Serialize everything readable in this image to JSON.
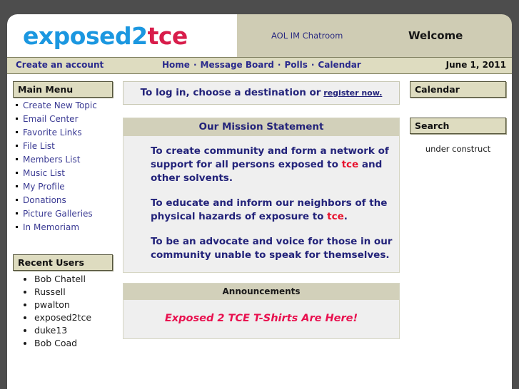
{
  "header": {
    "logo_prefix": "exposed2",
    "logo_suffix": "tce",
    "chatroom_link": "AOL IM Chatroom",
    "welcome": "Welcome"
  },
  "navbar": {
    "create_account": "Create an account",
    "links": [
      "Home",
      "Message Board",
      "Polls",
      "Calendar"
    ],
    "separator": "·",
    "date": "June 1, 2011"
  },
  "sidebar_left": {
    "main_menu_title": "Main Menu",
    "menu_items": [
      "Create New Topic",
      "Email Center",
      "Favorite Links",
      "File List",
      "Members List",
      "Music List",
      "My Profile",
      "Donations",
      "Picture Galleries",
      "In Memoriam"
    ],
    "recent_users_title": "Recent Users",
    "recent_users": [
      "Bob Chatell",
      "Russell",
      "pwalton",
      "exposed2tce",
      "duke13",
      "Bob Coad"
    ]
  },
  "main": {
    "login_prompt": "To log in, choose a destination or",
    "register_link": "register now.",
    "mission_title": "Our Mission Statement",
    "mission_paragraphs": [
      {
        "before": "To create community and form a network of support for all persons exposed to ",
        "highlight": "tce",
        "after": " and other solvents."
      },
      {
        "before": "To educate and inform our neighbors of the physical hazards of exposure to ",
        "highlight": "tce",
        "after": "."
      },
      {
        "before": "To be an advocate and voice for those in our community unable to speak for themselves.",
        "highlight": "",
        "after": ""
      }
    ],
    "announcements_title": "Announcements",
    "announcement_headline": "Exposed 2 TCE T-Shirts Are Here!"
  },
  "sidebar_right": {
    "calendar_title": "Calendar",
    "search_title": "Search",
    "search_note": "under construct"
  },
  "colors": {
    "page_background": "#4d4d4d",
    "header_beige": "#cfccb4",
    "navbar_beige": "#dedcc0",
    "panel_head_beige": "#dedcc0",
    "box_head_beige": "#d2d0ba",
    "link_navy": "#3a3a93",
    "heading_navy": "#23237a",
    "logo_blue": "#1b97e0",
    "logo_red": "#d81d4b",
    "tce_red": "#e8112d",
    "announce_pink": "#e8114f",
    "content_gray": "#efefef"
  }
}
